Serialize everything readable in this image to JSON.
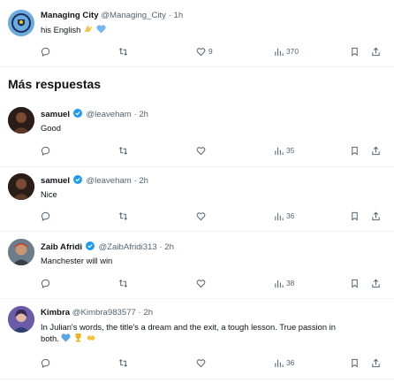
{
  "colors": {
    "text": "#0f1419",
    "muted": "#536471",
    "verified": "#1d9bf0",
    "border": "#eff3f4"
  },
  "section_title": "Más respuestas",
  "tweets": [
    {
      "name": "Managing City",
      "handle": "@Managing_City",
      "time": "1h",
      "text": "his English",
      "emoji": [
        "clap",
        "blue-heart"
      ],
      "verified": false,
      "counts": {
        "replies": "",
        "retweets": "",
        "likes": "9",
        "views": "370"
      }
    },
    {
      "name": "samuel",
      "handle": "@leaveham",
      "time": "2h",
      "text": "Good",
      "verified": true,
      "counts": {
        "replies": "",
        "retweets": "",
        "likes": "",
        "views": "35"
      }
    },
    {
      "name": "samuel",
      "handle": "@leaveham",
      "time": "2h",
      "text": "Nice",
      "verified": true,
      "counts": {
        "replies": "",
        "retweets": "",
        "likes": "",
        "views": "36"
      }
    },
    {
      "name": "Zaib Afridi",
      "handle": "@ZaibAfridi313",
      "time": "2h",
      "text": "Manchester will win",
      "verified": true,
      "counts": {
        "replies": "",
        "retweets": "",
        "likes": "",
        "views": "38"
      }
    },
    {
      "name": "Kimbra",
      "handle": "@Kimbra983577",
      "time": "2h",
      "text": "In Julian's words, the title's a dream and the exit, a tough lesson. True passion in both.",
      "emoji": [
        "blue-heart",
        "trophy",
        "handshake"
      ],
      "verified": false,
      "counts": {
        "replies": "",
        "retweets": "",
        "likes": "",
        "views": "36"
      }
    }
  ],
  "icons": {
    "reply": "reply-icon",
    "retweet": "retweet-icon",
    "like": "heart-icon",
    "views": "views-icon",
    "bookmark": "bookmark-icon",
    "share": "share-icon"
  }
}
